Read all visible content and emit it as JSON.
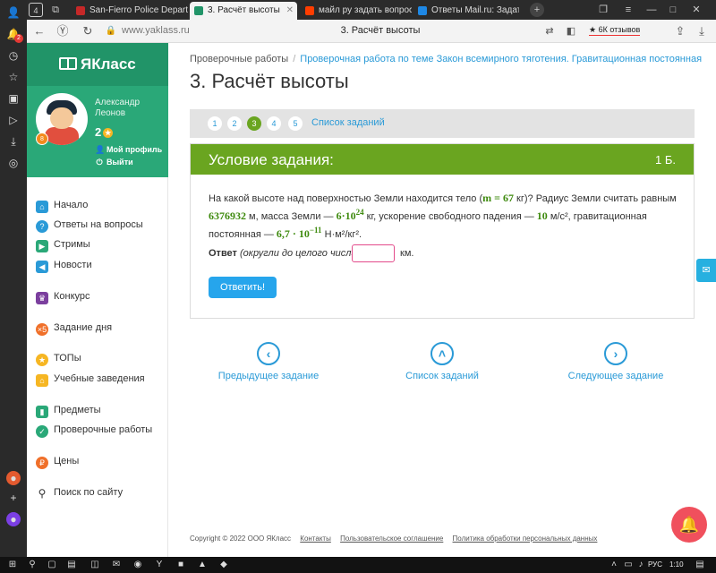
{
  "rail": {
    "notif_badge": "2"
  },
  "browser": {
    "home_tab_count": "4",
    "tabs": [
      {
        "title": "San-Fierro Police Departan",
        "fav_color": "#c62828"
      },
      {
        "title": "3. Расчёт высоты",
        "fav_color": "#219468"
      },
      {
        "title": "майл ру задать вопрос —",
        "fav_color": "#ff3d00"
      },
      {
        "title": "Ответы Mail.ru: Задать воп",
        "fav_color": "#1e88e5"
      }
    ],
    "url": "www.yaklass.ru",
    "page_title": "3. Расчёт высоты",
    "reviews": "★ 6К отзывов"
  },
  "sidebar": {
    "logo": "ЯКласс",
    "user_name": "Александр Леонов",
    "points": "2",
    "level": "8",
    "profile_link": "Мой профиль",
    "logout_link": "Выйти",
    "items": [
      {
        "label": "Начало",
        "icon": "home-icon",
        "color": "#2a9ad7"
      },
      {
        "label": "Ответы на вопросы",
        "icon": "question-icon",
        "color": "#2a9ad7"
      },
      {
        "label": "Стримы",
        "icon": "play-icon",
        "color": "#2aa878"
      },
      {
        "label": "Новости",
        "icon": "megaphone-icon",
        "color": "#2a9ad7"
      },
      {
        "label": "Конкурс",
        "icon": "trophy-icon",
        "color": "#7b3f9e"
      },
      {
        "label": "Задание дня",
        "icon": "x5-icon",
        "color": "#f0702a"
      },
      {
        "label": "ТОПы",
        "icon": "star-icon",
        "color": "#f6b623"
      },
      {
        "label": "Учебные заведения",
        "icon": "school-icon",
        "color": "#f6b623"
      },
      {
        "label": "Предметы",
        "icon": "books-icon",
        "color": "#2aa878"
      },
      {
        "label": "Проверочные работы",
        "icon": "check-icon",
        "color": "#2aa878"
      },
      {
        "label": "Цены",
        "icon": "coin-icon",
        "color": "#f0702a"
      },
      {
        "label": "Поиск по сайту",
        "icon": "search-icon",
        "color": "#333333"
      }
    ]
  },
  "main": {
    "breadcrumb_root": "Проверочные работы",
    "breadcrumb_link": "Проверочная работа по теме Закон всемирного тяготения. Гравитационная постоянная",
    "title": "3. Расчёт высоты",
    "pager": [
      "1",
      "2",
      "3",
      "4",
      "5"
    ],
    "active_page": "3",
    "task_list_link": "Список заданий",
    "task_header": "Условие задания:",
    "task_points": "1 Б.",
    "task": {
      "t1": "На какой высоте над поверхностью Земли находится тело (",
      "m_eq": "m = 67",
      "t2": " кг)? Радиус Земли считать равным ",
      "radius": "6376932",
      "t3": " м, масса Земли — ",
      "mass_base": "6·10",
      "mass_exp": "24",
      "t4": " кг, ускорение свободного падения — ",
      "g": "10",
      "t5": " м/с², гравитационная постоянная — ",
      "G_base": "6,7 · 10",
      "G_exp": "−11",
      "t6": " Н·м²/кг²."
    },
    "answer_label": "Ответ",
    "answer_hint": "(округли до целого числа):",
    "answer_value": "",
    "answer_unit": "км.",
    "submit_label": "Ответить!",
    "nav": {
      "prev": "Предыдущее задание",
      "list": "Список заданий",
      "next": "Следующее задание"
    },
    "footer": {
      "copyright": "Copyright © 2022 ООО ЯКласс",
      "links": [
        "Контакты",
        "Пользовательское соглашение",
        "Политика обработки персональных данных"
      ]
    }
  },
  "taskbar": {
    "lang": "РУС",
    "time": "1:10"
  }
}
